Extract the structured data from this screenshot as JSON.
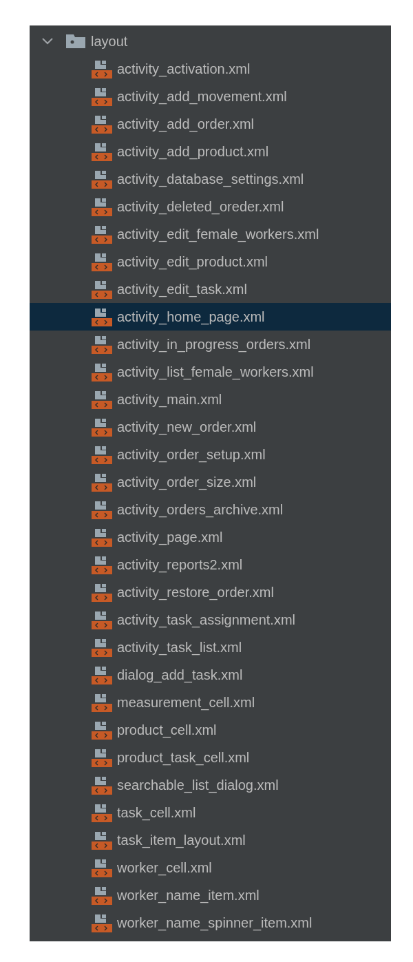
{
  "tree": {
    "label": "layout",
    "expanded": true,
    "children": [
      {
        "label": "activity_activation.xml",
        "selected": false
      },
      {
        "label": "activity_add_movement.xml",
        "selected": false
      },
      {
        "label": "activity_add_order.xml",
        "selected": false
      },
      {
        "label": "activity_add_product.xml",
        "selected": false
      },
      {
        "label": "activity_database_settings.xml",
        "selected": false
      },
      {
        "label": "activity_deleted_oreder.xml",
        "selected": false
      },
      {
        "label": "activity_edit_female_workers.xml",
        "selected": false
      },
      {
        "label": "activity_edit_product.xml",
        "selected": false
      },
      {
        "label": "activity_edit_task.xml",
        "selected": false
      },
      {
        "label": "activity_home_page.xml",
        "selected": true
      },
      {
        "label": "activity_in_progress_orders.xml",
        "selected": false
      },
      {
        "label": "activity_list_female_workers.xml",
        "selected": false
      },
      {
        "label": "activity_main.xml",
        "selected": false
      },
      {
        "label": "activity_new_order.xml",
        "selected": false
      },
      {
        "label": "activity_order_setup.xml",
        "selected": false
      },
      {
        "label": "activity_order_size.xml",
        "selected": false
      },
      {
        "label": "activity_orders_archive.xml",
        "selected": false
      },
      {
        "label": "activity_page.xml",
        "selected": false
      },
      {
        "label": "activity_reports2.xml",
        "selected": false
      },
      {
        "label": "activity_restore_order.xml",
        "selected": false
      },
      {
        "label": "activity_task_assignment.xml",
        "selected": false
      },
      {
        "label": "activity_task_list.xml",
        "selected": false
      },
      {
        "label": "dialog_add_task.xml",
        "selected": false
      },
      {
        "label": "measurement_cell.xml",
        "selected": false
      },
      {
        "label": "product_cell.xml",
        "selected": false
      },
      {
        "label": "product_task_cell.xml",
        "selected": false
      },
      {
        "label": "searchable_list_dialog.xml",
        "selected": false
      },
      {
        "label": "task_cell.xml",
        "selected": false
      },
      {
        "label": "task_item_layout.xml",
        "selected": false
      },
      {
        "label": "worker_cell.xml",
        "selected": false
      },
      {
        "label": "worker_name_item.xml",
        "selected": false
      },
      {
        "label": "worker_name_spinner_item.xml",
        "selected": false
      }
    ]
  }
}
